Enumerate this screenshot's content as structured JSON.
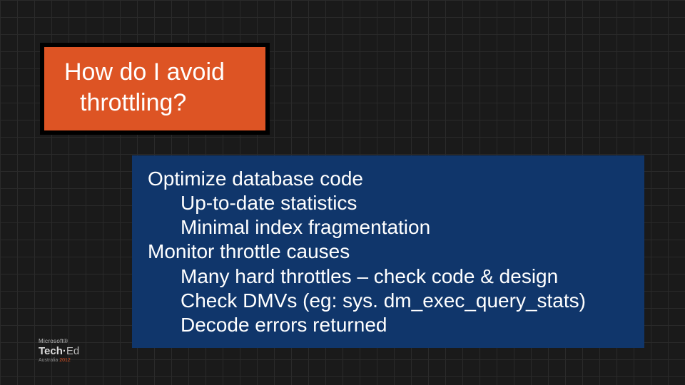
{
  "title": {
    "line1": "How do I avoid",
    "line2": "throttling?"
  },
  "content": {
    "items": [
      {
        "level": 0,
        "text": "Optimize database code"
      },
      {
        "level": 1,
        "text": "Up-to-date statistics"
      },
      {
        "level": 1,
        "text": "Minimal index fragmentation"
      },
      {
        "level": 0,
        "text": "Monitor throttle causes"
      },
      {
        "level": 1,
        "text": "Many hard throttles – check code & design"
      },
      {
        "level": 1,
        "text": "Check DMVs (eg: sys. dm_exec_query_stats)"
      },
      {
        "level": 1,
        "text": "Decode errors returned"
      }
    ]
  },
  "branding": {
    "vendor": "Microsoft®",
    "event_a": "Tech·",
    "event_b": "Ed",
    "loc": "Australia ",
    "year": "2012"
  }
}
